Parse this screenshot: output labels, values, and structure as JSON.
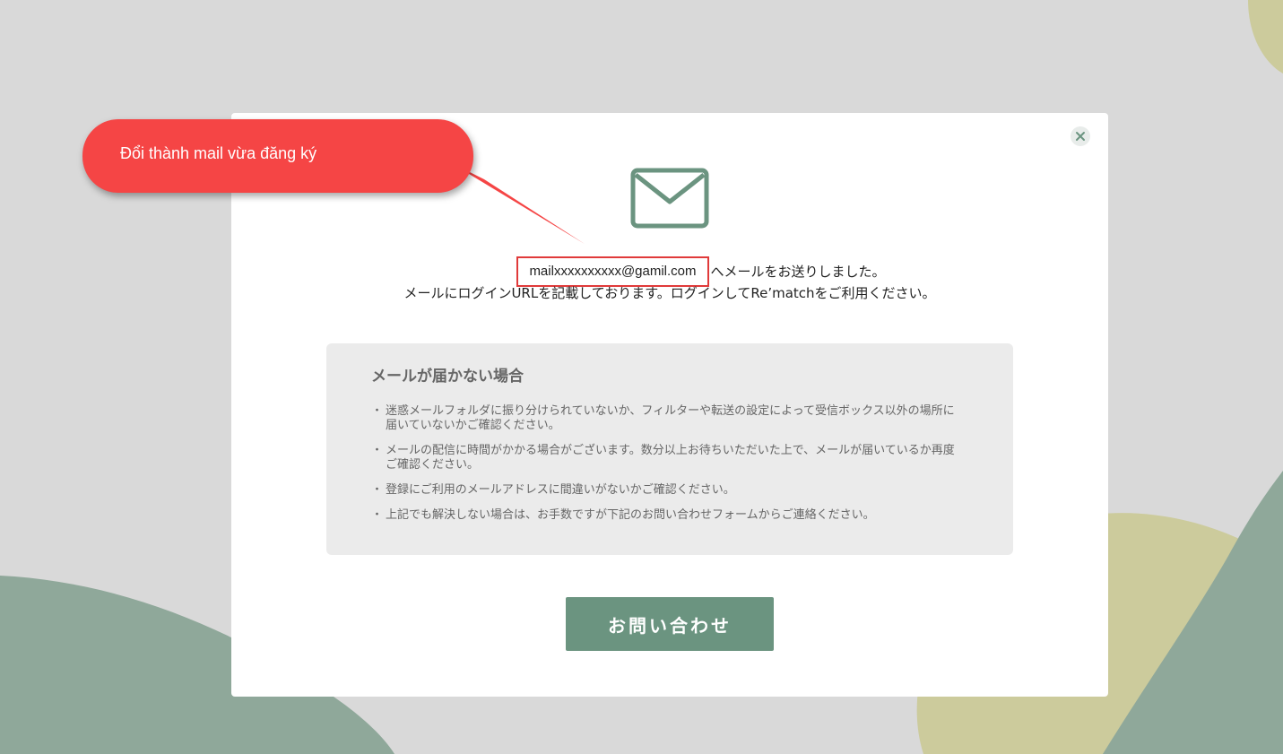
{
  "colors": {
    "background": "#d9d9d9",
    "accent_green": "#6b9480",
    "shape_green": "#8fa89a",
    "shape_olive": "#cccb9c",
    "callout_red": "#f54545",
    "highlight_red": "#e03a3a"
  },
  "annotation": {
    "callout_text": "Đổi thành mail vừa đăng ký"
  },
  "modal": {
    "close_icon": "close-icon",
    "mail_icon": "envelope-icon",
    "email": "mailxxxxxxxxxx@gamil.com",
    "sent_suffix": "へメールをお送りしました。",
    "login_message": "メールにログインURLを記載しております。ログインしてRe’matchをご利用ください。",
    "help": {
      "title": "メールが届かない場合",
      "items": [
        "迷惑メールフォルダに振り分けられていないか、フィルターや転送の設定によって受信ボックス以外の場所に届いていないかご確認ください。",
        "メールの配信に時間がかかる場合がございます。数分以上お待ちいただいた上で、メールが届いているか再度ご確認ください。",
        "登録にご利用のメールアドレスに間違いがないかご確認ください。",
        "上記でも解決しない場合は、お手数ですが下記のお問い合わせフォームからご連絡ください。"
      ]
    },
    "contact_button": "お問い合わせ"
  }
}
